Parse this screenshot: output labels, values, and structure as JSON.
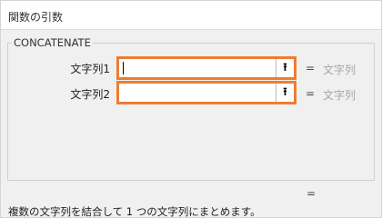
{
  "dialog": {
    "title": "関数の引数",
    "function_name": "CONCATENATE",
    "args": [
      {
        "label": "文字列1",
        "value": "",
        "equals": "=",
        "result": "文字列"
      },
      {
        "label": "文字列2",
        "value": "",
        "equals": "=",
        "result": "文字列"
      }
    ],
    "collapse_icon": "collapse-arrow-icon",
    "collapse_glyph": "⭱",
    "result_equals": "=",
    "description": "複数の文字列を結合して 1 つの文字列にまとめます。",
    "accent_color": "#ed7d31"
  }
}
